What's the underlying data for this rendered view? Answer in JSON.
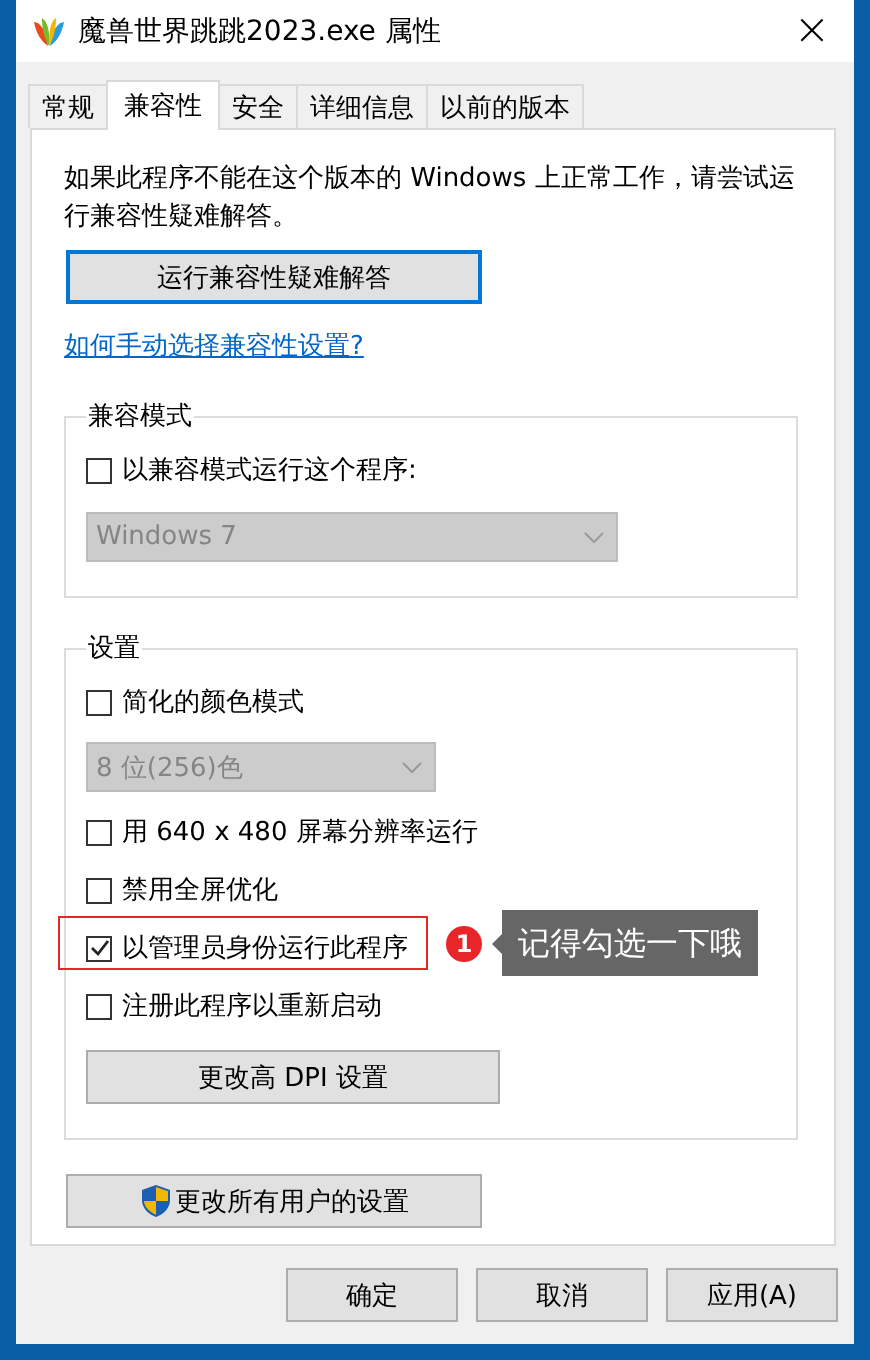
{
  "window": {
    "title": "魔兽世界跳跳2023.exe 属性",
    "close": "×"
  },
  "tabs": [
    {
      "label": "常规",
      "selected": false
    },
    {
      "label": "兼容性",
      "selected": true
    },
    {
      "label": "安全",
      "selected": false
    },
    {
      "label": "详细信息",
      "selected": false
    },
    {
      "label": "以前的版本",
      "selected": false
    }
  ],
  "intro": "如果此程序不能在这个版本的 Windows 上正常工作，请尝试运行兼容性疑难解答。",
  "troubleshoot_button": {
    "label": "运行兼容性疑难解答",
    "focused": true
  },
  "help_link": "如何手动选择兼容性设置?",
  "compat_group": {
    "title": "兼容模式",
    "items": [
      {
        "kind": "checkbox",
        "label": "以兼容模式运行这个程序:",
        "checked": false,
        "highlighted": false
      },
      {
        "kind": "dropdown",
        "value": "Windows 7",
        "disabled": true
      }
    ]
  },
  "settings_group": {
    "title": "设置",
    "items": [
      {
        "kind": "checkbox",
        "label": "简化的颜色模式",
        "checked": false,
        "highlighted": false
      },
      {
        "kind": "dropdown",
        "value": "8 位(256)色",
        "disabled": true
      },
      {
        "kind": "checkbox",
        "label": "用 640 x 480 屏幕分辨率运行",
        "checked": false,
        "highlighted": false
      },
      {
        "kind": "checkbox",
        "label": "禁用全屏优化",
        "checked": false,
        "highlighted": false
      },
      {
        "kind": "checkbox",
        "label": "以管理员身份运行此程序",
        "checked": true,
        "highlighted": true
      },
      {
        "kind": "checkbox",
        "label": "注册此程序以重新启动",
        "checked": false,
        "highlighted": false
      },
      {
        "kind": "button",
        "label": "更改高 DPI 设置"
      }
    ]
  },
  "all_users_button": {
    "label": "更改所有用户的设置"
  },
  "annotation": {
    "number": "1",
    "text": "记得勾选一下哦"
  },
  "buttons": [
    {
      "label": "确定"
    },
    {
      "label": "取消"
    },
    {
      "label": "应用(A)"
    }
  ]
}
